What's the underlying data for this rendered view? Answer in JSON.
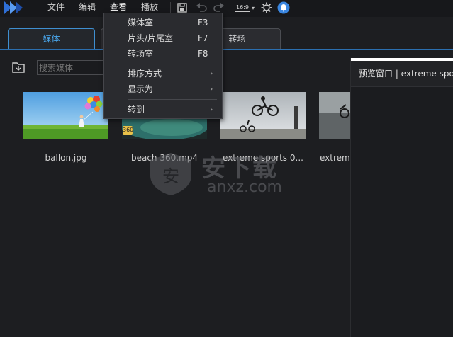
{
  "menubar": {
    "items": [
      "文件",
      "编辑",
      "查看",
      "播放"
    ],
    "aspect_ratio": "16:9",
    "icons": [
      "app-logo-icon",
      "save-icon",
      "undo-icon",
      "redo-icon",
      "aspect-ratio-icon",
      "settings-gear-icon",
      "notification-bell-icon"
    ]
  },
  "tabs": [
    "媒体",
    "转场"
  ],
  "library": {
    "search_placeholder": "搜索媒体",
    "media": [
      {
        "name": "ballon.jpg"
      },
      {
        "name": "beach 360.mp4",
        "badge": "360"
      },
      {
        "name": "extreme sports 0..."
      },
      {
        "name": "extreme"
      }
    ]
  },
  "preview": {
    "title": "预览窗口 | extreme spo"
  },
  "view_menu": {
    "items": [
      {
        "label": "媒体室",
        "shortcut": "F3"
      },
      {
        "label": "片头/片尾室",
        "shortcut": "F7"
      },
      {
        "label": "转场室",
        "shortcut": "F8"
      },
      {
        "label": "排序方式",
        "submenu": true
      },
      {
        "label": "显示为",
        "submenu": true
      },
      {
        "label": "转到",
        "submenu": true
      }
    ],
    "submenu_arrow": "›"
  },
  "watermark": {
    "text_cn": "安下载",
    "text_en": "anxz.com",
    "shield_char": "安"
  },
  "colors": {
    "accent": "#3f8fd0",
    "active_tab_text": "#4aa8ef",
    "background": "#1d1e21"
  }
}
